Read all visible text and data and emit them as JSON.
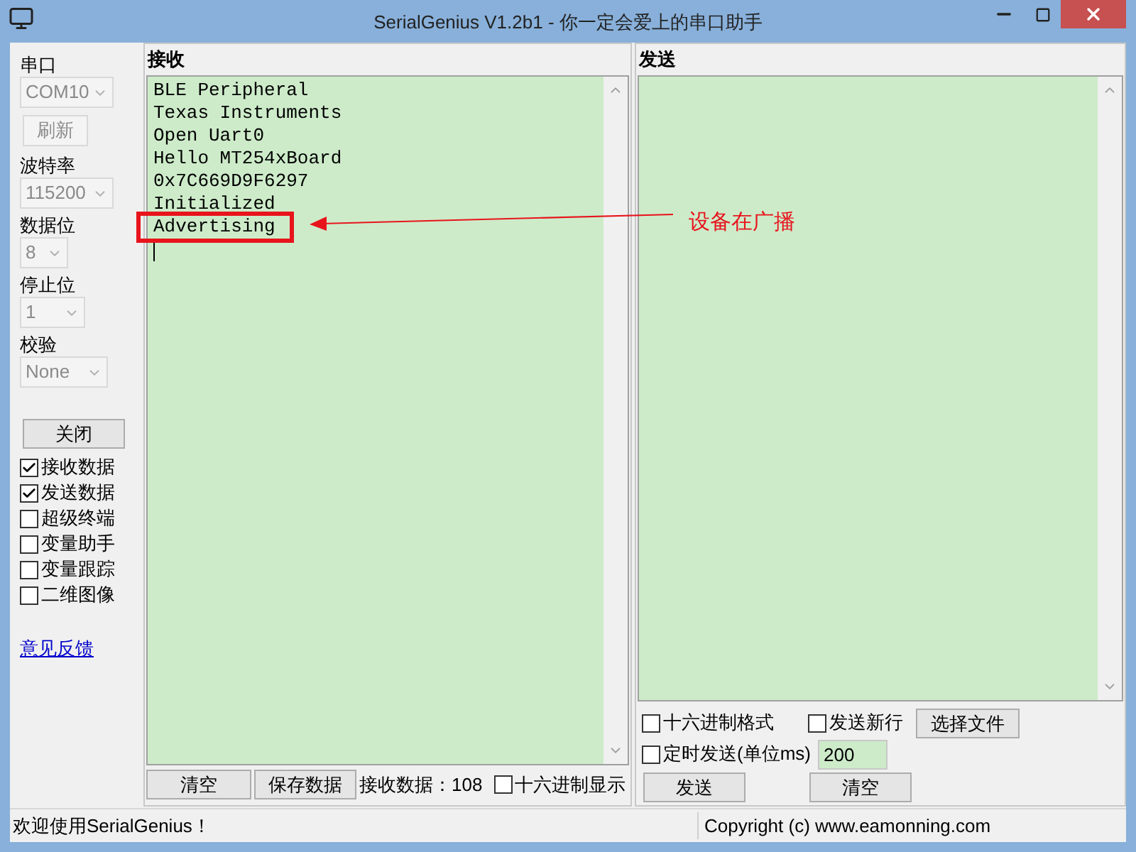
{
  "window": {
    "title": "SerialGenius V1.2b1 - 你一定会爱上的串口助手"
  },
  "settings": [
    {
      "label": "串口",
      "value": "COM10",
      "disabled": true,
      "button": {
        "label": "刷新",
        "disabled": true
      }
    },
    {
      "label": "波特率",
      "value": "115200",
      "disabled": true
    },
    {
      "label": "数据位",
      "value": "8",
      "disabled": true
    },
    {
      "label": "停止位",
      "value": "1",
      "disabled": true
    },
    {
      "label": "校验",
      "value": "None",
      "disabled": true
    }
  ],
  "open_button": "关闭",
  "options": [
    {
      "label": "接收数据",
      "checked": true
    },
    {
      "label": "发送数据",
      "checked": true
    },
    {
      "label": "超级终端",
      "checked": false
    },
    {
      "label": "变量助手",
      "checked": false
    },
    {
      "label": "变量跟踪",
      "checked": false
    },
    {
      "label": "二维图像",
      "checked": false
    }
  ],
  "feedback_link": "意见反馈",
  "receive": {
    "title": "接收",
    "lines": [
      {
        "text": "BLE Peripheral",
        "highlighted": false
      },
      {
        "text": "Texas Instruments",
        "highlighted": false
      },
      {
        "text": "Open Uart0",
        "highlighted": false
      },
      {
        "text": "Hello MT254xBoard",
        "highlighted": false
      },
      {
        "text": "0x7C669D9F6297",
        "highlighted": false
      },
      {
        "text": "Initialized",
        "highlighted": false
      },
      {
        "text": "Advertising",
        "highlighted": true
      }
    ],
    "clear_button": "清空",
    "save_button": "保存数据",
    "count": "接收数据：108",
    "hex_display": {
      "label": "十六进制显示",
      "checked": false
    }
  },
  "send": {
    "title": "发送",
    "hex_format": {
      "label": "十六进制格式",
      "checked": false
    },
    "newline": {
      "label": "发送新行",
      "checked": false
    },
    "file_button": "选择文件",
    "timer": {
      "label": "定时发送(单位ms)",
      "checked": false
    },
    "interval": "200",
    "send_button": "发送",
    "clear_button": "清空"
  },
  "annotation": {
    "text": "设备在广播"
  },
  "status_bar": {
    "message": "欢迎使用SerialGenius！",
    "copyright": "Copyright (c) www.eamonning.com"
  }
}
